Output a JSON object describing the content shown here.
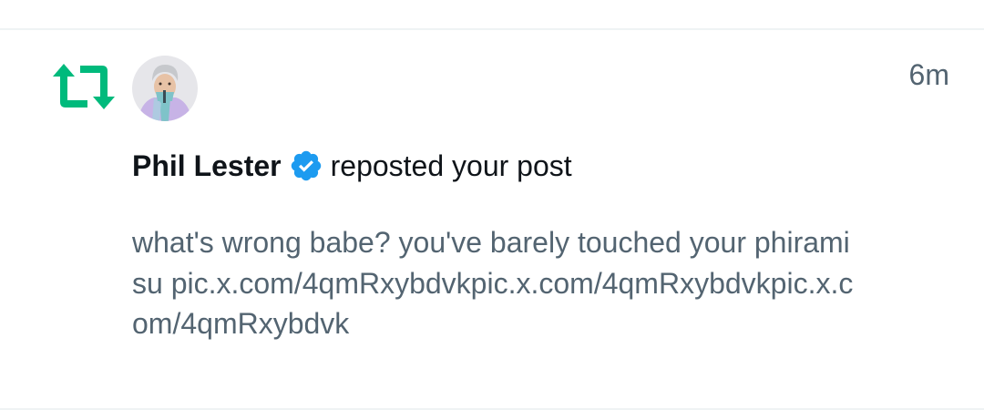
{
  "notification": {
    "timestamp": "6m",
    "user_name": "Phil Lester",
    "action_text": "reposted your post",
    "post_text": "what's wrong babe? you've barely touched your phiramisu pic.x.com/4qmRxybdvkpic.x.com/4qmRxybdvkpic.x.com/4qmRxybdvk"
  },
  "icons": {
    "repost": "repost-icon",
    "verified": "verified-badge-icon",
    "avatar": "avatar"
  },
  "colors": {
    "repost_green": "#00ba7c",
    "verified_blue": "#1d9bf0",
    "text_primary": "#0f1419",
    "text_secondary": "#536471",
    "divider": "#eff3f4"
  }
}
